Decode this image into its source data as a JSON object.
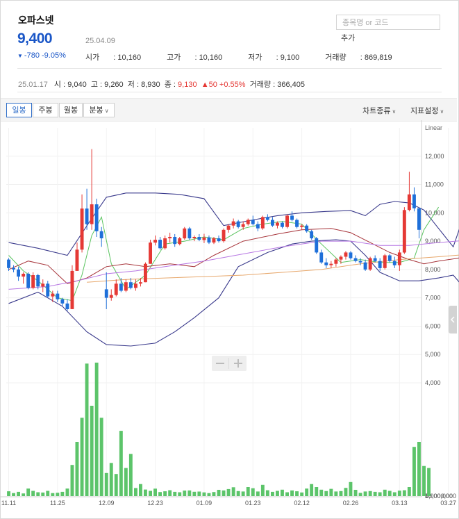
{
  "stock": {
    "name": "오파스넷",
    "price": "9,400",
    "date": "25.04.09",
    "change": "-780",
    "change_pct": "-9.05%",
    "open_label": "시가",
    "open": "10,160",
    "high_label": "고가",
    "high": "10,160",
    "low_label": "저가",
    "low": "9,100",
    "volume_label": "거래량",
    "volume": "869,819"
  },
  "search": {
    "placeholder": "종목명 or 코드",
    "add_label": "추가"
  },
  "snapshot": {
    "date": "25.01.17",
    "open_label": "시",
    "open": "9,040",
    "high_label": "고",
    "high": "9,260",
    "low_label": "저",
    "low": "8,930",
    "close_label": "종",
    "close": "9,130",
    "change": "50",
    "change_pct": "+0.55%",
    "volume_label": "거래량",
    "volume": "366,405"
  },
  "toolbar": {
    "periods": [
      "일봉",
      "주봉",
      "월봉",
      "분봉"
    ],
    "active_period": "일봉",
    "chart_type_label": "차트종류",
    "indicator_label": "지표설정"
  },
  "colors": {
    "up": "#e53935",
    "down": "#1e6fd9",
    "volume": "#5cc46a",
    "bollinger": "#3a3a8c",
    "ma5": "#59c35e",
    "ma20": "#a7343a",
    "ma60": "#b777e3",
    "ma120": "#e7a76b",
    "accent": "#1a56c7"
  },
  "chart_data": {
    "type": "candlestick",
    "scale_label": "Linear",
    "price_ylim": [
      4000,
      13000
    ],
    "price_ticks": [
      4000,
      5000,
      6000,
      7000,
      8000,
      9000,
      10000,
      11000,
      12000
    ],
    "volume_ylim": [
      0,
      4000000
    ],
    "volume_ticks": [
      0,
      5000000,
      10000000
    ],
    "x_labels": [
      {
        "label": "11.11",
        "index": 0
      },
      {
        "label": "11.25",
        "index": 10
      },
      {
        "label": "12.09",
        "index": 20
      },
      {
        "label": "12.23",
        "index": 30
      },
      {
        "label": "01.09",
        "index": 40
      },
      {
        "label": "01.23",
        "index": 50
      },
      {
        "label": "02.12",
        "index": 60
      },
      {
        "label": "02.26",
        "index": 70
      },
      {
        "label": "03.13",
        "index": 80
      },
      {
        "label": "03.27",
        "index": 90
      }
    ],
    "candles": [
      [
        8350,
        8400,
        7950,
        8050
      ],
      [
        8050,
        8150,
        7900,
        8000
      ],
      [
        8000,
        8100,
        7600,
        7750
      ],
      [
        7750,
        7900,
        7500,
        7850
      ],
      [
        7850,
        7900,
        7300,
        7350
      ],
      [
        7350,
        7900,
        7300,
        7800
      ],
      [
        7800,
        7850,
        7300,
        7400
      ],
      [
        7400,
        7650,
        7200,
        7500
      ],
      [
        7500,
        7600,
        7000,
        7050
      ],
      [
        7050,
        7250,
        6850,
        7150
      ],
      [
        7150,
        7250,
        6850,
        6950
      ],
      [
        6950,
        7000,
        6700,
        6800
      ],
      [
        6800,
        6950,
        6550,
        6600
      ],
      [
        6600,
        8150,
        6600,
        7950
      ],
      [
        7950,
        8950,
        7950,
        8700
      ],
      [
        8700,
        10650,
        8600,
        10150
      ],
      [
        10150,
        10850,
        9400,
        9600
      ],
      [
        9600,
        12250,
        9400,
        10300
      ],
      [
        10300,
        10500,
        9150,
        9350
      ],
      [
        9350,
        9500,
        8800,
        9100
      ],
      [
        7300,
        7900,
        6600,
        7000
      ],
      [
        7000,
        7300,
        6900,
        7100
      ],
      [
        7100,
        7650,
        7050,
        7500
      ],
      [
        7500,
        7700,
        7200,
        7250
      ],
      [
        7250,
        7650,
        7200,
        7550
      ],
      [
        7550,
        7700,
        7300,
        7350
      ],
      [
        7350,
        7650,
        7250,
        7500
      ],
      [
        7500,
        7700,
        7400,
        7550
      ],
      [
        7550,
        8250,
        7550,
        8200
      ],
      [
        8200,
        9050,
        8200,
        8950
      ],
      [
        8950,
        9200,
        8850,
        9050
      ],
      [
        9050,
        9150,
        8700,
        8750
      ],
      [
        8750,
        9200,
        8700,
        9100
      ],
      [
        9100,
        9300,
        8950,
        9150
      ],
      [
        9150,
        9250,
        8800,
        8900
      ],
      [
        8900,
        9150,
        8850,
        9100
      ],
      [
        9100,
        9500,
        9050,
        9450
      ],
      [
        9450,
        9500,
        9050,
        9100
      ],
      [
        9100,
        9200,
        9000,
        9150
      ],
      [
        9150,
        9250,
        9000,
        9050
      ],
      [
        9040,
        9260,
        8930,
        9130
      ],
      [
        9130,
        9200,
        8900,
        8950
      ],
      [
        8950,
        9150,
        8900,
        9100
      ],
      [
        9100,
        9200,
        8950,
        9000
      ],
      [
        9000,
        9450,
        8950,
        9400
      ],
      [
        9400,
        9600,
        9300,
        9550
      ],
      [
        9550,
        9800,
        9450,
        9700
      ],
      [
        9700,
        9750,
        9450,
        9500
      ],
      [
        9500,
        9700,
        9400,
        9600
      ],
      [
        9600,
        9800,
        9550,
        9750
      ],
      [
        9750,
        9900,
        9550,
        9600
      ],
      [
        9600,
        9700,
        9350,
        9450
      ],
      [
        9450,
        9900,
        9400,
        9850
      ],
      [
        9850,
        9950,
        9700,
        9750
      ],
      [
        9750,
        9850,
        9500,
        9550
      ],
      [
        9550,
        9700,
        9450,
        9650
      ],
      [
        9650,
        9700,
        9450,
        9500
      ],
      [
        9500,
        9950,
        9450,
        9900
      ],
      [
        9900,
        10050,
        9700,
        9750
      ],
      [
        9750,
        9800,
        9450,
        9500
      ],
      [
        9500,
        9600,
        9400,
        9550
      ],
      [
        9550,
        9600,
        9300,
        9350
      ],
      [
        9350,
        9400,
        9050,
        9100
      ],
      [
        9100,
        9150,
        8550,
        8600
      ],
      [
        8600,
        8700,
        8200,
        8250
      ],
      [
        8250,
        8400,
        8050,
        8150
      ],
      [
        8150,
        8300,
        8050,
        8200
      ],
      [
        8200,
        8400,
        8100,
        8350
      ],
      [
        8350,
        8500,
        8200,
        8450
      ],
      [
        8450,
        8650,
        8350,
        8600
      ],
      [
        8600,
        8650,
        8350,
        8400
      ],
      [
        8400,
        8500,
        8250,
        8300
      ],
      [
        8300,
        8400,
        8150,
        8250
      ],
      [
        8250,
        8350,
        7950,
        8000
      ],
      [
        8000,
        8450,
        7950,
        8400
      ],
      [
        8400,
        8500,
        8250,
        8300
      ],
      [
        8300,
        8400,
        7950,
        8050
      ],
      [
        8050,
        8550,
        8000,
        8500
      ],
      [
        8500,
        8550,
        8250,
        8300
      ],
      [
        8300,
        8450,
        8050,
        8150
      ],
      [
        8150,
        8700,
        7950,
        8600
      ],
      [
        8600,
        10200,
        8550,
        10100
      ],
      [
        10100,
        11450,
        10050,
        10650
      ],
      [
        10650,
        10900,
        10050,
        10160
      ],
      [
        10160,
        10160,
        9100,
        9400
      ]
    ],
    "volume": [
      480,
      300,
      420,
      260,
      750,
      520,
      380,
      350,
      520,
      300,
      330,
      420,
      750,
      3100,
      5400,
      7800,
      13200,
      9000,
      13300,
      7800,
      2300,
      3300,
      2200,
      6500,
      2800,
      4200,
      800,
      1200,
      650,
      520,
      740,
      400,
      480,
      580,
      420,
      380,
      550,
      560,
      430,
      450,
      366,
      300,
      400,
      620,
      560,
      700,
      880,
      500,
      460,
      900,
      780,
      460,
      1120,
      580,
      420,
      520,
      640,
      380,
      560,
      480,
      360,
      750,
      1200,
      900,
      640,
      500,
      720,
      460,
      500,
      820,
      1400,
      620,
      320,
      460,
      500,
      420,
      380,
      640,
      520,
      380,
      540,
      580,
      900,
      4900,
      5400,
      3000,
      2800
    ],
    "bollinger": {
      "upper": [
        [
          0,
          8950
        ],
        [
          6,
          8750
        ],
        [
          12,
          8500
        ],
        [
          17,
          9800
        ],
        [
          20,
          10550
        ],
        [
          24,
          10700
        ],
        [
          30,
          10700
        ],
        [
          35,
          10650
        ],
        [
          40,
          10500
        ],
        [
          44,
          9550
        ],
        [
          50,
          9750
        ],
        [
          55,
          9900
        ],
        [
          60,
          10000
        ],
        [
          65,
          10050
        ],
        [
          70,
          10080
        ],
        [
          73,
          9900
        ],
        [
          76,
          10300
        ],
        [
          79,
          10400
        ],
        [
          82,
          10350
        ],
        [
          85,
          10100
        ],
        [
          88,
          9450
        ],
        [
          91,
          8800
        ],
        [
          94,
          10300
        ],
        [
          98,
          10400
        ]
      ],
      "lower": [
        [
          0,
          6800
        ],
        [
          6,
          7200
        ],
        [
          11,
          6700
        ],
        [
          16,
          5800
        ],
        [
          20,
          5350
        ],
        [
          25,
          5300
        ],
        [
          30,
          5400
        ],
        [
          34,
          5800
        ],
        [
          38,
          6300
        ],
        [
          43,
          7000
        ],
        [
          47,
          8100
        ],
        [
          53,
          8600
        ],
        [
          58,
          8900
        ],
        [
          62,
          9000
        ],
        [
          67,
          9050
        ],
        [
          70,
          9000
        ],
        [
          73,
          8500
        ],
        [
          76,
          7900
        ],
        [
          80,
          7600
        ],
        [
          84,
          7600
        ],
        [
          88,
          7700
        ],
        [
          91,
          7800
        ],
        [
          93,
          7400
        ],
        [
          95,
          7000
        ],
        [
          98,
          6950
        ]
      ],
      "color": "#3a3a8c"
    },
    "moving_averages": [
      {
        "name": "ma5",
        "color": "#59c35e",
        "points": [
          [
            0,
            8500
          ],
          [
            3,
            7950
          ],
          [
            6,
            7600
          ],
          [
            10,
            7000
          ],
          [
            13,
            6900
          ],
          [
            15,
            7800
          ],
          [
            17,
            9200
          ],
          [
            19,
            9850
          ],
          [
            21,
            8200
          ],
          [
            24,
            7300
          ],
          [
            28,
            7800
          ],
          [
            32,
            8900
          ],
          [
            36,
            9000
          ],
          [
            40,
            9150
          ],
          [
            44,
            9050
          ],
          [
            48,
            9450
          ],
          [
            52,
            9600
          ],
          [
            56,
            9700
          ],
          [
            60,
            9600
          ],
          [
            64,
            8900
          ],
          [
            68,
            8250
          ],
          [
            72,
            8350
          ],
          [
            76,
            8250
          ],
          [
            80,
            8250
          ],
          [
            83,
            8400
          ],
          [
            85,
            9400
          ],
          [
            88,
            10200
          ]
        ]
      },
      {
        "name": "ma20",
        "color": "#a7343a",
        "points": [
          [
            0,
            8000
          ],
          [
            4,
            8300
          ],
          [
            8,
            8150
          ],
          [
            12,
            7500
          ],
          [
            16,
            7700
          ],
          [
            20,
            8100
          ],
          [
            24,
            8200
          ],
          [
            28,
            8100
          ],
          [
            33,
            8200
          ],
          [
            38,
            8100
          ],
          [
            42,
            8500
          ],
          [
            48,
            9000
          ],
          [
            55,
            9250
          ],
          [
            60,
            9400
          ],
          [
            66,
            9450
          ],
          [
            70,
            9300
          ],
          [
            74,
            8950
          ],
          [
            78,
            8600
          ],
          [
            82,
            8350
          ],
          [
            85,
            8200
          ],
          [
            88,
            8300
          ],
          [
            92,
            8400
          ],
          [
            95,
            8600
          ]
        ]
      },
      {
        "name": "ma60",
        "color": "#b777e3",
        "points": [
          [
            0,
            7300
          ],
          [
            8,
            7400
          ],
          [
            14,
            7600
          ],
          [
            20,
            7850
          ],
          [
            26,
            7950
          ],
          [
            32,
            8100
          ],
          [
            40,
            8300
          ],
          [
            48,
            8550
          ],
          [
            56,
            8800
          ],
          [
            64,
            9000
          ],
          [
            70,
            9000
          ],
          [
            76,
            8850
          ],
          [
            82,
            8850
          ],
          [
            88,
            8950
          ],
          [
            95,
            9050
          ]
        ]
      },
      {
        "name": "ma120",
        "color": "#e7a76b",
        "points": [
          [
            16,
            7550
          ],
          [
            24,
            7650
          ],
          [
            32,
            7700
          ],
          [
            40,
            7750
          ],
          [
            48,
            7800
          ],
          [
            56,
            7900
          ],
          [
            64,
            8000
          ],
          [
            72,
            8200
          ],
          [
            80,
            8350
          ],
          [
            88,
            8450
          ],
          [
            95,
            8550
          ]
        ]
      }
    ]
  }
}
